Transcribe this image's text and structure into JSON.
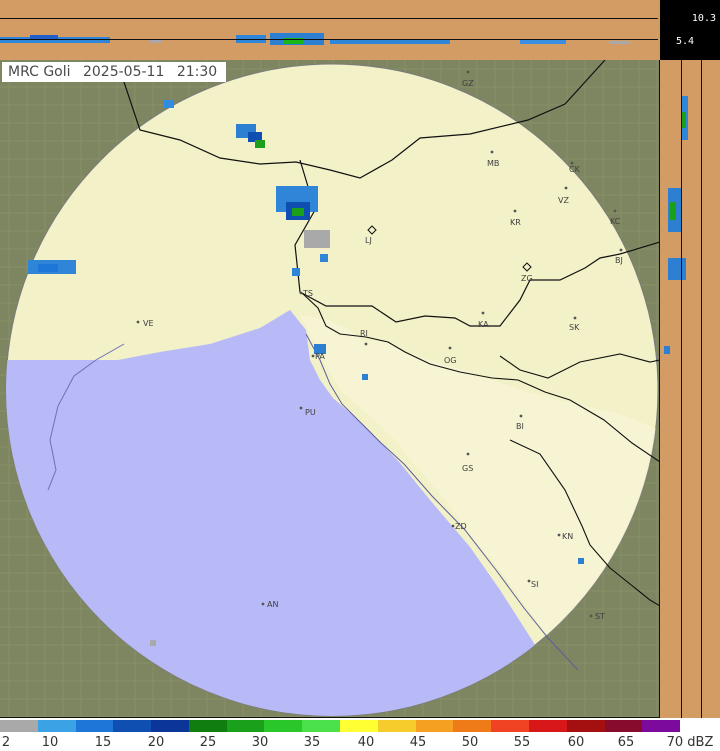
{
  "header": {
    "station": "MRC Goli",
    "date": "2025-05-11",
    "time": "21:30"
  },
  "height_scale": {
    "top": "10.3",
    "middle": "5.4"
  },
  "legend": {
    "unit": "dBZ",
    "ticks": [
      "2",
      "10",
      "15",
      "20",
      "25",
      "30",
      "35",
      "40",
      "45",
      "50",
      "55",
      "60",
      "65",
      "70 dBZ"
    ],
    "colors": [
      "#a9a9a9",
      "#3ba2e6",
      "#1e77d8",
      "#0f4fb1",
      "#0c3599",
      "#0f7d0f",
      "#1aa01a",
      "#29c729",
      "#4be14b",
      "#ffff33",
      "#f5cc2c",
      "#f6a021",
      "#ef7a18",
      "#f04323",
      "#d81818",
      "#a40f0f",
      "#870b2b",
      "#7c0a9c"
    ]
  },
  "map": {
    "background": "#6f7b59",
    "coverage_ring": "#f2f1c8",
    "sea": "#b6b7f5",
    "borders": "#101010",
    "cities": [
      {
        "id": "GZ",
        "label": "GZ"
      },
      {
        "id": "MB",
        "label": "MB"
      },
      {
        "id": "CK",
        "label": "CK"
      },
      {
        "id": "VZ",
        "label": "VZ"
      },
      {
        "id": "KR",
        "label": "KR"
      },
      {
        "id": "KC",
        "label": "KC"
      },
      {
        "id": "LJ",
        "label": "LJ"
      },
      {
        "id": "ZG",
        "label": "ZG"
      },
      {
        "id": "BJ",
        "label": "BJ"
      },
      {
        "id": "TS",
        "label": "TS"
      },
      {
        "id": "VE",
        "label": "VE"
      },
      {
        "id": "RI",
        "label": "RI"
      },
      {
        "id": "KA",
        "label": "KA"
      },
      {
        "id": "SK",
        "label": "SK"
      },
      {
        "id": "PA",
        "label": "PA"
      },
      {
        "id": "OG",
        "label": "OG"
      },
      {
        "id": "PU",
        "label": "PU"
      },
      {
        "id": "BI",
        "label": "BI"
      },
      {
        "id": "GS",
        "label": "GS"
      },
      {
        "id": "ZD",
        "label": "ZD"
      },
      {
        "id": "KN",
        "label": "KN"
      },
      {
        "id": "SI",
        "label": "SI"
      },
      {
        "id": "AN",
        "label": "AN"
      },
      {
        "id": "ST",
        "label": "ST"
      }
    ]
  }
}
